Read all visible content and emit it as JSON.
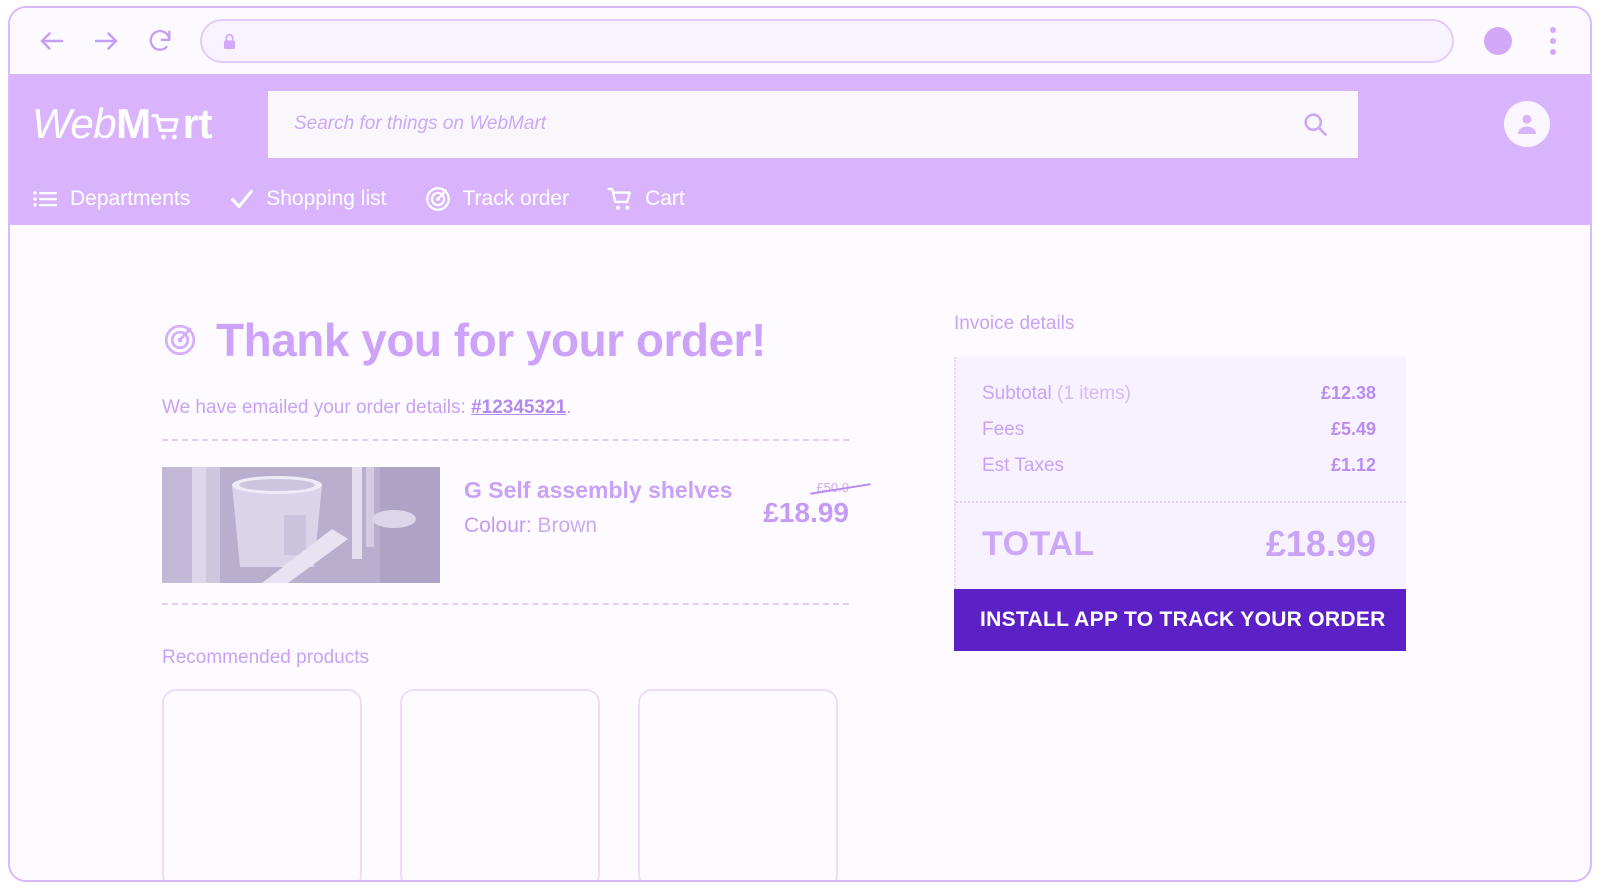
{
  "browser": {
    "back_icon": "arrow-left-icon",
    "forward_icon": "arrow-right-icon",
    "reload_icon": "reload-icon",
    "lock_icon": "lock-icon",
    "url_value": "",
    "url_placeholder": "",
    "profile_icon": "profile-circle-icon",
    "menu_icon": "kebab-menu-icon"
  },
  "header": {
    "brand": {
      "part1": "Web",
      "part2": "M",
      "cart_icon": "shopping-cart-icon",
      "part3": "rt"
    },
    "search": {
      "value": "",
      "placeholder": "Search for things on WebMart",
      "icon": "search-icon"
    },
    "account_icon": "account-avatar-icon",
    "nav": [
      {
        "label": "Departments",
        "icon": "list-icon"
      },
      {
        "label": "Shopping list",
        "icon": "check-icon"
      },
      {
        "label": "Track order",
        "icon": "radar-target-icon"
      },
      {
        "label": "Cart",
        "icon": "shopping-cart-icon"
      }
    ]
  },
  "main": {
    "thankyou": {
      "icon": "radar-target-icon",
      "title": "Thank you for your order!"
    },
    "emailed": {
      "prefix": "We have emailed your order details: ",
      "order_number": "#12345321",
      "suffix": "."
    },
    "product": {
      "title": "G Self assembly shelves",
      "colour_label": "Colour:",
      "colour_value": "Brown",
      "old_price": "£50.0",
      "price": "£18.99"
    },
    "recommended": {
      "title": "Recommended products",
      "cards": [
        "",
        "",
        ""
      ]
    }
  },
  "invoice": {
    "title": "Invoice details",
    "rows": [
      {
        "label": "Subtotal",
        "sub": "(1 items)",
        "value": "£12.38"
      },
      {
        "label": "Fees",
        "sub": "",
        "value": "£5.49"
      },
      {
        "label": "Est Taxes",
        "sub": "",
        "value": "£1.12"
      }
    ],
    "total_label": "TOTAL",
    "total_value": "£18.99",
    "cta_label": "INSTALL APP TO TRACK YOUR ORDER"
  },
  "colors": {
    "header_purple": "#d9b4fd",
    "accent_text": "#c8a2f4",
    "cta_purple": "#5b21c7",
    "panel_bg": "#f8f1fe",
    "page_bg": "#fdfbff"
  }
}
